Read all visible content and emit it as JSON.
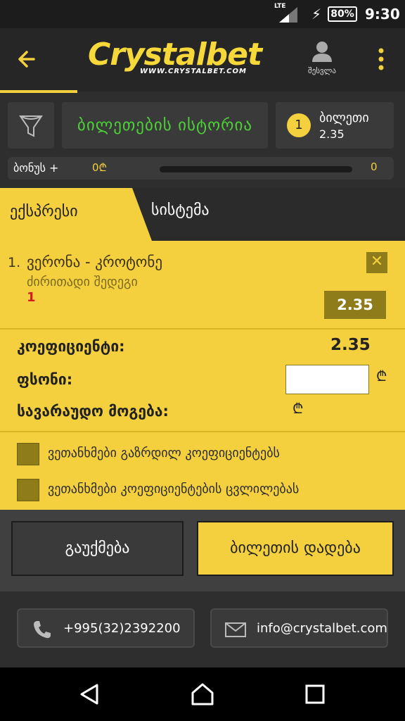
{
  "status_bar": {
    "network": "LTE",
    "battery": "80%",
    "time": "9:30"
  },
  "header": {
    "brand": "Crystalbet",
    "brand_url": "WWW.CRYSTALBET.COM",
    "profile_label": "შესვლა"
  },
  "toolbar": {
    "history_label": "ბილეთების ისტორია",
    "ticket_count": "1",
    "ticket_label": "ბილეთი",
    "ticket_odds": "2.35"
  },
  "bonus": {
    "label": "ბონუს +",
    "value": "0₾",
    "progress_value": "0",
    "progress_fraction": 0
  },
  "bet_tabs": {
    "express": "ექსპრესი",
    "system": "სისტემა"
  },
  "selection": {
    "index": "1.",
    "event": "ვერონა - კროტონე",
    "market": "ძირითადი შედეგი",
    "pick": "1",
    "odds": "2.35",
    "remove_icon": "close-icon"
  },
  "summary": {
    "coef_label": "კოეფიციენტი:",
    "coef_value": "2.35",
    "stake_label": "ფსონი:",
    "stake_value": "",
    "currency": "₾",
    "win_label": "სავარაუდო მოგება:"
  },
  "options": [
    {
      "label": "ვეთანხმები გაზრდილ კოეფიციენტებს",
      "checked": false
    },
    {
      "label": "ვეთანხმები კოეფიციენტების ცვლილებას",
      "checked": false
    }
  ],
  "actions": {
    "cancel": "გაუქმება",
    "place": "ბილეთის დადება"
  },
  "contact": {
    "phone": "+995(32)2392200",
    "email": "info@crystalbet.com"
  },
  "colors": {
    "accent_yellow": "#f4d03f",
    "dark_bg": "#2e2e2e",
    "green_text": "#4cd137",
    "pick_red": "#d21d1d"
  }
}
